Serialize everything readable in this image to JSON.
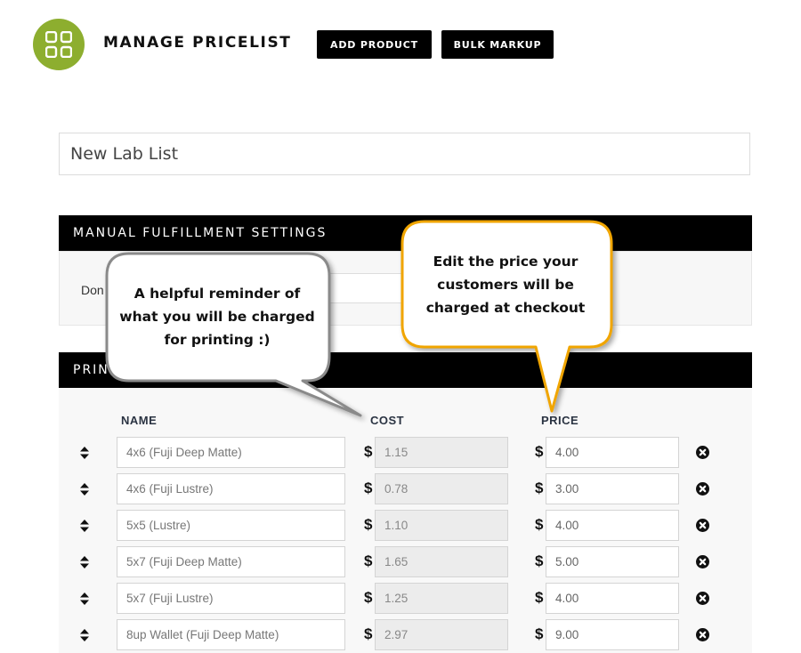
{
  "header": {
    "logo_icon": "grid-icon",
    "title": "MANAGE PRICELIST",
    "add_product_label": "ADD PRODUCT",
    "bulk_markup_label": "BULK MARKUP"
  },
  "pricelist_name": "New Lab List",
  "manual_fulfillment": {
    "title": "MANUAL FULFILLMENT SETTINGS",
    "field_label_visible": "Don"
  },
  "print_section": {
    "title_visible": "PRIN"
  },
  "columns": {
    "name": "NAME",
    "cost": "COST",
    "price": "PRICE"
  },
  "currency_symbol": "$",
  "products": [
    {
      "name": "4x6 (Fuji Deep Matte)",
      "cost": "1.15",
      "price": "4.00"
    },
    {
      "name": "4x6 (Fuji Lustre)",
      "cost": "0.78",
      "price": "3.00"
    },
    {
      "name": "5x5 (Lustre)",
      "cost": "1.10",
      "price": "4.00"
    },
    {
      "name": "5x7 (Fuji Deep Matte)",
      "cost": "1.65",
      "price": "5.00"
    },
    {
      "name": "5x7 (Fuji Lustre)",
      "cost": "1.25",
      "price": "4.00"
    },
    {
      "name": "8up Wallet (Fuji Deep Matte)",
      "cost": "2.97",
      "price": "9.00"
    }
  ],
  "callouts": {
    "cost_note": "A helpful reminder of what you will be charged for printing :)",
    "price_note": "Edit the price your customers will be charged at checkout"
  },
  "colors": {
    "logo_green": "#8dae2f",
    "callout_orange": "#f0a500",
    "callout_gray": "#8a8a8a"
  }
}
